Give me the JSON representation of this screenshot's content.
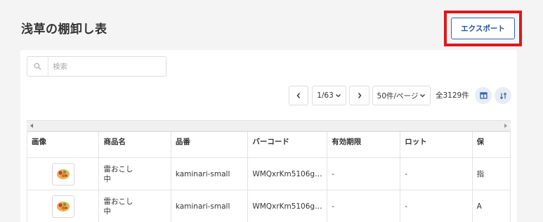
{
  "page": {
    "title": "浅草の棚卸し表"
  },
  "toolbar": {
    "export_label": "エクスポート"
  },
  "search": {
    "placeholder": "検索"
  },
  "pagination": {
    "page_indicator": "1/63",
    "per_page": "50件/ページ",
    "total": "全3129件"
  },
  "table": {
    "columns": [
      "画像",
      "商品名",
      "品番",
      "バーコード",
      "有効期限",
      "ロット",
      "保"
    ],
    "rows": [
      {
        "name_line1": "雷おこし",
        "name_line2": "中",
        "sku": "kaminari-small",
        "barcode": "WMQxrKm5106g…",
        "expiry": "-",
        "lot": "-",
        "extra": "指"
      },
      {
        "name_line1": "雷おこし",
        "name_line2": "中",
        "sku": "kaminari-small",
        "barcode": "WMQxrKm5106g…",
        "expiry": "-",
        "lot": "-",
        "extra": "A"
      }
    ]
  },
  "colors": {
    "accent": "#1f4f9e",
    "highlight": "#e0161b"
  }
}
